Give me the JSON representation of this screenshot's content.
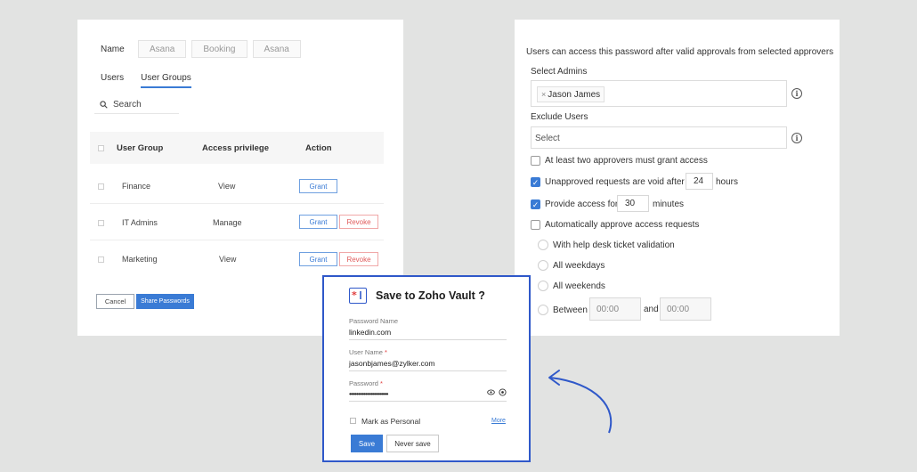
{
  "left_panel": {
    "name_label": "Name",
    "name_values": [
      "Asana",
      "Booking",
      "Asana"
    ],
    "tabs": [
      "Users",
      "User Groups"
    ],
    "active_tab": "User Groups",
    "search_placeholder": "Search",
    "table": {
      "headers": [
        "User Group",
        "Access privilege",
        "Action"
      ],
      "rows": [
        {
          "group": "Finance",
          "privilege": "View",
          "grant": "Grant"
        },
        {
          "group": "IT Admins",
          "privilege": "Manage",
          "grant": "Grant",
          "revoke": "Revoke"
        },
        {
          "group": "Marketing",
          "privilege": "View",
          "grant": "Grant",
          "revoke": "Revoke"
        }
      ]
    },
    "cancel_label": "Cancel",
    "share_label": "Share Passwords"
  },
  "right_panel": {
    "intro": "Users can access this password after valid approvals from selected approvers",
    "select_admins_label": "Select Admins",
    "selected_admin": "Jason James",
    "exclude_users_label": "Exclude Users",
    "exclude_placeholder": "Select",
    "info_icon": "i",
    "options": {
      "two_approvers": "At least two approvers must grant access",
      "void_prefix": "Unapproved requests are void after",
      "void_value": "24",
      "void_suffix": "hours",
      "provide_prefix": "Provide access for",
      "provide_value": "30",
      "provide_suffix": "minutes",
      "auto_approve": "Automatically approve access requests"
    },
    "radios": {
      "helpdesk": "With help desk ticket validation",
      "weekdays": "All weekdays",
      "weekends": "All weekends",
      "between": "Between",
      "from_time": "00:00",
      "and": "and",
      "to_time": "00:00"
    }
  },
  "dialog": {
    "title": "Save to Zoho Vault ?",
    "password_name_label": "Password Name",
    "password_name_value": "linkedin.com",
    "username_label": "User Name",
    "username_value": "jasonbjames@zylker.com",
    "password_label": "Password",
    "password_value": "••••••••••••••••••••••",
    "required_mark": "*",
    "mark_personal_label": "Mark as Personal",
    "more_link": "More",
    "save_label": "Save",
    "never_save_label": "Never save"
  },
  "colors": {
    "accent": "#3a7bd5",
    "dialog_border": "#2f58c9",
    "danger": "#e05c5c",
    "background": "#e2e3e2"
  }
}
